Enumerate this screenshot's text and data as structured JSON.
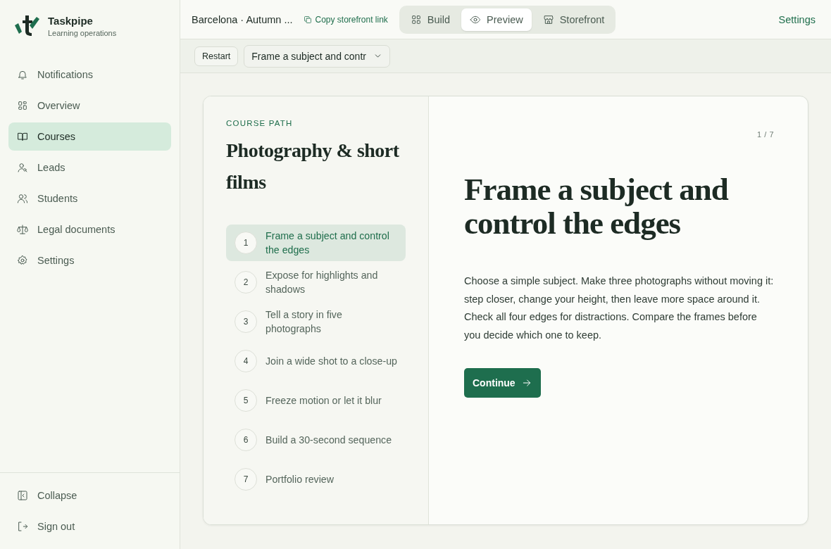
{
  "brand": {
    "name": "Taskpipe",
    "subtitle": "Learning operations"
  },
  "sidebar": {
    "items": [
      {
        "label": "Notifications",
        "selected": false
      },
      {
        "label": "Overview",
        "selected": false
      },
      {
        "label": "Courses",
        "selected": true
      },
      {
        "label": "Leads",
        "selected": false
      },
      {
        "label": "Students",
        "selected": false
      },
      {
        "label": "Legal documents",
        "selected": false
      },
      {
        "label": "Settings",
        "selected": false
      }
    ],
    "footer": [
      {
        "label": "Collapse"
      },
      {
        "label": "Sign out"
      }
    ]
  },
  "topbar": {
    "title": "Barcelona · Autumn ...",
    "copy_link": "Copy storefront link",
    "tabs": [
      {
        "label": "Build",
        "selected": false
      },
      {
        "label": "Preview",
        "selected": true
      },
      {
        "label": "Storefront",
        "selected": false
      }
    ],
    "settings": "Settings"
  },
  "toolbar": {
    "restart": "Restart",
    "step_select": "Frame a subject and contr"
  },
  "course": {
    "eyebrow": "COURSE PATH",
    "title": "Photography & short films",
    "steps": [
      {
        "number": "1",
        "label": "Frame a subject and control the edges",
        "selected": true
      },
      {
        "number": "2",
        "label": "Expose for highlights and shadows",
        "selected": false
      },
      {
        "number": "3",
        "label": "Tell a story in five photographs",
        "selected": false
      },
      {
        "number": "4",
        "label": "Join a wide shot to a close-up",
        "selected": false
      },
      {
        "number": "5",
        "label": "Freeze motion or let it blur",
        "selected": false
      },
      {
        "number": "6",
        "label": "Build a 30-second sequence",
        "selected": false
      },
      {
        "number": "7",
        "label": "Portfolio review",
        "selected": false
      }
    ]
  },
  "lesson": {
    "counter": "1 / 7",
    "title": "Frame a subject and control the edges",
    "body": "Choose a simple subject. Make three photographs without moving it: step closer, change your height, then leave more space around it. Check all four edges for distractions. Compare the frames before you decide which one to keep.",
    "button": "Continue"
  }
}
